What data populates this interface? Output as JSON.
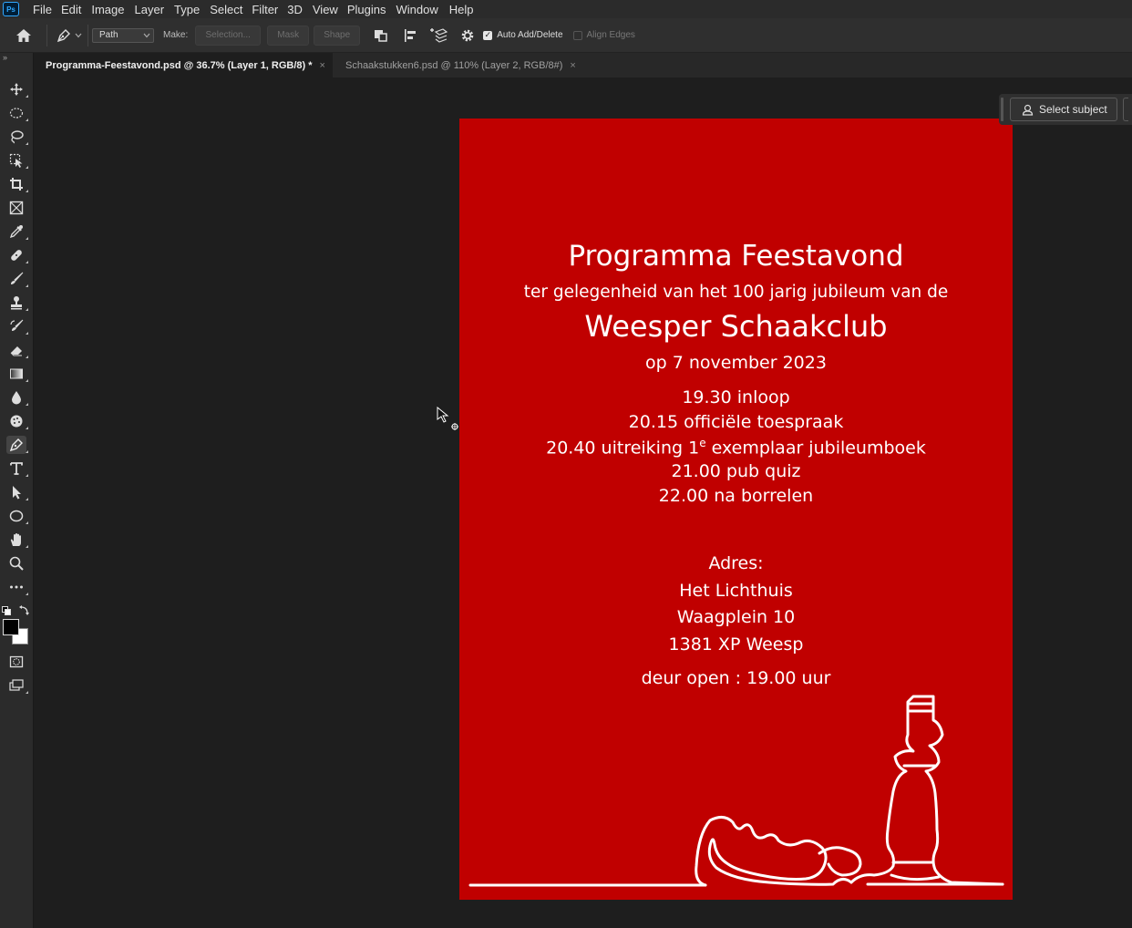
{
  "app": {
    "logo": "Ps"
  },
  "menu": [
    "File",
    "Edit",
    "Image",
    "Layer",
    "Type",
    "Select",
    "Filter",
    "3D",
    "View",
    "Plugins",
    "Window",
    "Help"
  ],
  "options": {
    "mode_select": "Path",
    "make_label": "Make:",
    "selection_btn": "Selection...",
    "mask_btn": "Mask",
    "shape_btn": "Shape",
    "auto_add_delete_label": "Auto Add/Delete",
    "auto_add_delete_checked": true,
    "align_edges_label": "Align Edges",
    "align_edges_checked": false
  },
  "tabs": [
    {
      "title": "Programma-Feestavond.psd @ 36.7% (Layer 1, RGB/8) *",
      "active": true,
      "close": "×"
    },
    {
      "title": "Schaakstukken6.psd @ 110% (Layer 2, RGB/8#)",
      "active": false,
      "close": "×"
    }
  ],
  "select_subject": {
    "label": "Select subject"
  },
  "document": {
    "background_color": "#c00000",
    "title": "Programma Feestavond",
    "subtitle": "ter gelegenheid van het 100 jarig jubileum van de",
    "club": "Weesper Schaakclub",
    "date": "op 7 november 2023",
    "program": [
      {
        "text": "19.30 inloop"
      },
      {
        "text": "20.15 officiële toespraak"
      },
      {
        "before": "20.40 uitreiking 1",
        "sup": "e",
        "after": " exemplaar jubileumboek"
      },
      {
        "text": "21.00 pub quiz"
      },
      {
        "text": "22.00 na borrelen"
      }
    ],
    "address_label": "Adres:",
    "address_lines": [
      "Het Lichthuis",
      "Waagplein 10",
      "1381 XP Weesp"
    ],
    "door_open": "deur open : 19.00 uur",
    "illustration": "chess-king-and-fallen-piece-line-art"
  },
  "colors": {
    "foreground": "#000000",
    "background": "#ffffff"
  }
}
